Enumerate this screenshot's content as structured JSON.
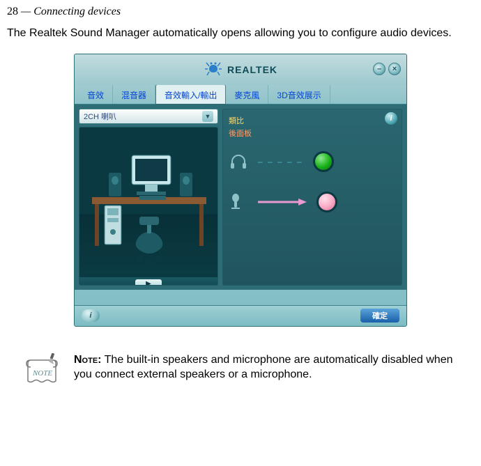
{
  "header": {
    "page_number": "28",
    "separator": " — ",
    "chapter_title": "Connecting devices"
  },
  "intro_text": "The Realtek Sound Manager automatically opens allowing you to configure audio devices.",
  "app": {
    "brand_name": "REALTEK",
    "minimize_symbol": "–",
    "close_symbol": "×",
    "tabs": [
      "音效",
      "混音器",
      "音效輸入/輸出",
      "麥克風",
      "3D音效展示"
    ],
    "dropdown_value": "2CH 喇叭",
    "right_panel": {
      "label_top": "類比",
      "label_back_panel": "後面板"
    },
    "help_symbol": "i",
    "info_symbol": "i",
    "ok_label": "確定",
    "play_symbol": "▶"
  },
  "note": {
    "icon_label": "NOTE",
    "heading": "Note:",
    "body": " The built-in speakers and microphone are automatically disabled when you connect external speakers or a microphone."
  }
}
